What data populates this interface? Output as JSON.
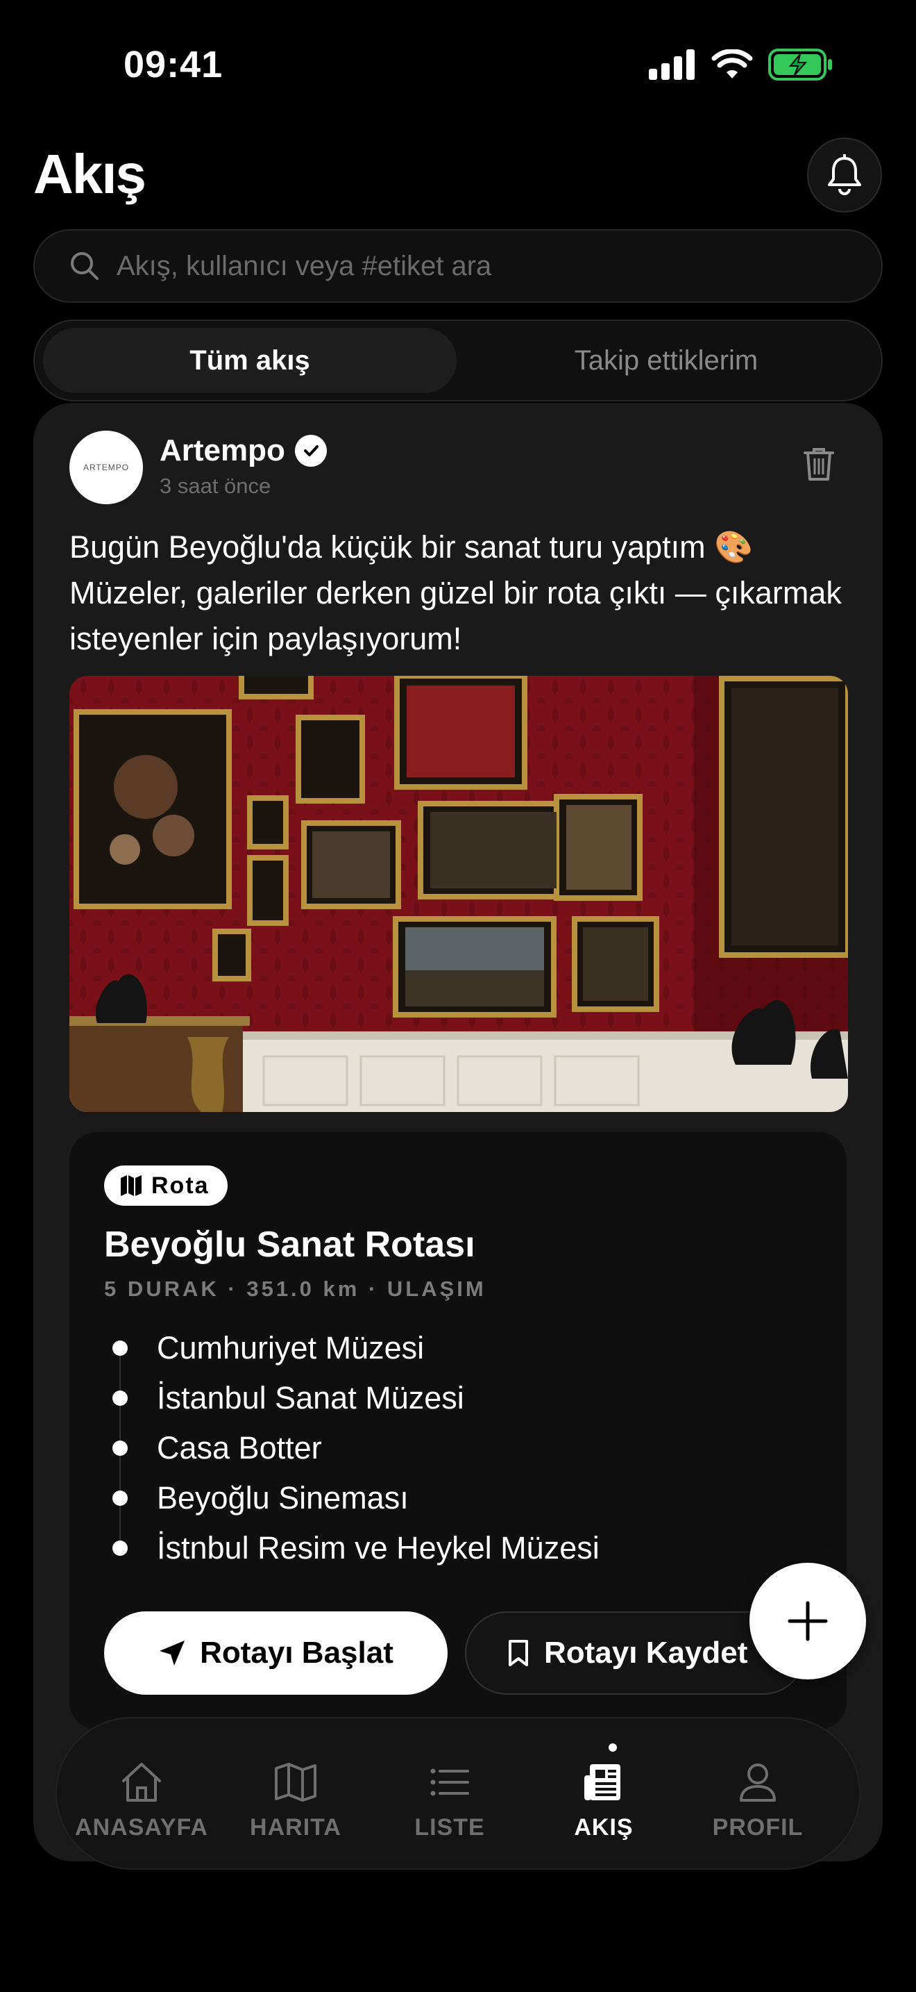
{
  "status_bar": {
    "time": "09:41"
  },
  "header": {
    "title": "Akış"
  },
  "search": {
    "placeholder": "Akış, kullanıcı veya #etiket ara"
  },
  "feed_tabs": {
    "active": "Tüm akış",
    "inactive": "Takip ettiklerim"
  },
  "post": {
    "author": "Artempo",
    "avatar_text": "ARTEMPO",
    "time_ago": "3 saat önce",
    "text": "Bugün Beyoğlu'da küçük bir sanat turu yaptım 🎨 Müzeler, galeriler derken güzel bir rota çıktı — çıkarmak isteyenler için paylaşıyorum!",
    "route": {
      "badge": "Rota",
      "title": "Beyoğlu Sanat Rotası",
      "meta": "5 DURAK · 351.0 km · ULAŞIM",
      "stops": [
        "Cumhuriyet Müzesi",
        "İstanbul Sanat Müzesi",
        "Casa Botter",
        "Beyoğlu Sineması",
        "İstnbul Resim ve Heykel Müzesi"
      ],
      "start_button": "Rotayı Başlat",
      "save_button": "Rotayı Kaydet"
    }
  },
  "tabbar": {
    "items": [
      {
        "label": "ANASAYFA",
        "icon": "home-icon"
      },
      {
        "label": "HARITA",
        "icon": "map-icon"
      },
      {
        "label": "LISTE",
        "icon": "list-icon"
      },
      {
        "label": "AKIŞ",
        "icon": "newspaper-icon"
      },
      {
        "label": "PROFIL",
        "icon": "user-icon"
      }
    ],
    "active_index": 3
  },
  "colors": {
    "background": "#000000",
    "card": "#1a1a1a",
    "gallery_wall": "#7a1119",
    "battery_green": "#34c759"
  }
}
